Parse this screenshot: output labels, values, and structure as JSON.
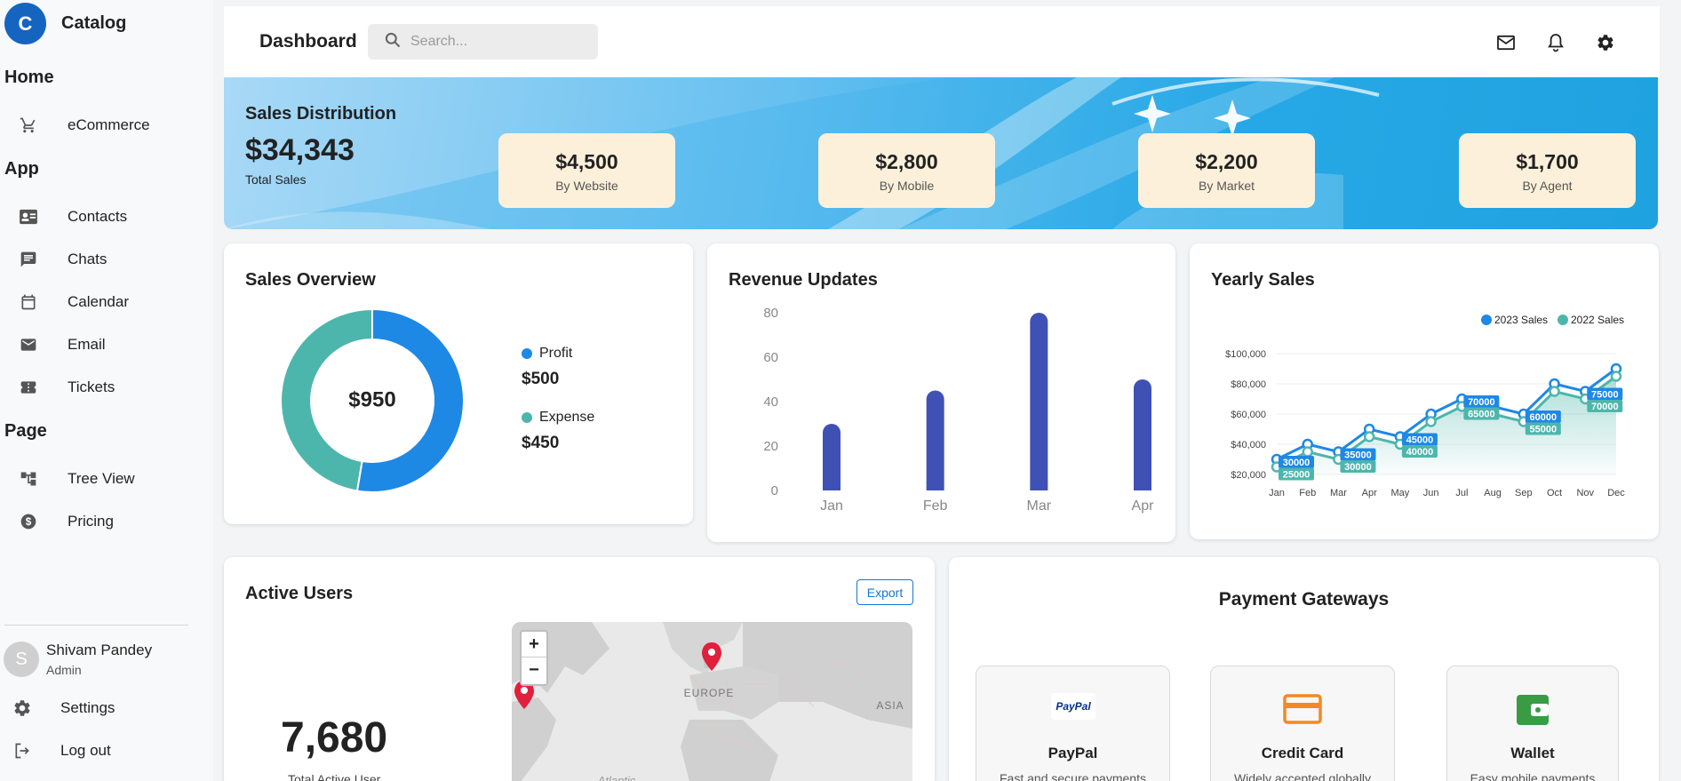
{
  "brand": {
    "logo_letter": "C",
    "name": "Catalog"
  },
  "sidebar": {
    "sections": [
      {
        "title": "Home",
        "items": [
          {
            "label": "eCommerce",
            "icon": "cart-icon"
          }
        ]
      },
      {
        "title": "App",
        "items": [
          {
            "label": "Contacts",
            "icon": "contact-card-icon"
          },
          {
            "label": "Chats",
            "icon": "chat-icon"
          },
          {
            "label": "Calendar",
            "icon": "calendar-icon"
          },
          {
            "label": "Email",
            "icon": "mail-icon"
          },
          {
            "label": "Tickets",
            "icon": "ticket-icon"
          }
        ]
      },
      {
        "title": "Page",
        "items": [
          {
            "label": "Tree View",
            "icon": "tree-icon"
          },
          {
            "label": "Pricing",
            "icon": "dollar-icon"
          }
        ]
      }
    ],
    "user": {
      "initial": "S",
      "name": "Shivam Pandey",
      "role": "Admin"
    },
    "settings_label": "Settings",
    "logout_label": "Log out"
  },
  "header": {
    "title": "Dashboard",
    "search_placeholder": "Search..."
  },
  "banner": {
    "title": "Sales Distribution",
    "total": "$34,343",
    "total_label": "Total Sales",
    "cards": [
      {
        "value": "$4,500",
        "label": "By Website"
      },
      {
        "value": "$2,800",
        "label": "By Mobile"
      },
      {
        "value": "$2,200",
        "label": "By Market"
      },
      {
        "value": "$1,700",
        "label": "By Agent"
      }
    ]
  },
  "colors": {
    "primary": "#1e88e5",
    "teal": "#4db6ac",
    "bar": "#3f51b5",
    "accent": "#1976d2"
  },
  "sales_overview": {
    "title": "Sales Overview",
    "center_value": "$950",
    "legend": [
      {
        "name": "Profit",
        "value": "$500"
      },
      {
        "name": "Expense",
        "value": "$450"
      }
    ]
  },
  "revenue": {
    "title": "Revenue Updates"
  },
  "yearly": {
    "title": "Yearly Sales"
  },
  "chart_data": [
    {
      "type": "pie",
      "title": "Sales Overview",
      "categories": [
        "Profit",
        "Expense"
      ],
      "values": [
        500,
        450
      ]
    },
    {
      "type": "bar",
      "title": "Revenue Updates",
      "categories": [
        "Jan",
        "Feb",
        "Mar",
        "Apr"
      ],
      "values": [
        30,
        45,
        80,
        50
      ],
      "yticks": [
        "0",
        "20",
        "40",
        "60",
        "80"
      ],
      "ylim": [
        0,
        80
      ]
    },
    {
      "type": "area",
      "title": "Yearly Sales",
      "categories": [
        "Jan",
        "Feb",
        "Mar",
        "Apr",
        "May",
        "Jun",
        "Jul",
        "Aug",
        "Sep",
        "Oct",
        "Nov",
        "Dec"
      ],
      "series": [
        {
          "name": "2023 Sales",
          "values": [
            30000,
            40000,
            35000,
            50000,
            45000,
            60000,
            70000,
            65000,
            60000,
            80000,
            75000,
            90000
          ]
        },
        {
          "name": "2022 Sales",
          "values": [
            25000,
            35000,
            30000,
            45000,
            40000,
            55000,
            65000,
            60000,
            55000,
            75000,
            70000,
            85000
          ]
        }
      ],
      "point_labels": [
        {
          "series": 0,
          "index": 0,
          "text": "30000"
        },
        {
          "series": 1,
          "index": 0,
          "text": "25000"
        },
        {
          "series": 0,
          "index": 2,
          "text": "35000"
        },
        {
          "series": 1,
          "index": 2,
          "text": "30000"
        },
        {
          "series": 0,
          "index": 4,
          "text": "45000"
        },
        {
          "series": 1,
          "index": 4,
          "text": "40000"
        },
        {
          "series": 0,
          "index": 6,
          "text": "70000"
        },
        {
          "series": 1,
          "index": 6,
          "text": "65000"
        },
        {
          "series": 0,
          "index": 8,
          "text": "60000"
        },
        {
          "series": 1,
          "index": 8,
          "text": "55000"
        },
        {
          "series": 0,
          "index": 10,
          "text": "75000"
        },
        {
          "series": 1,
          "index": 10,
          "text": "70000"
        }
      ],
      "yticks": [
        "$20,000",
        "$40,000",
        "$60,000",
        "$80,000",
        "$100,000"
      ],
      "ylim": [
        20000,
        100000
      ],
      "legend": "top-right"
    }
  ],
  "active_users": {
    "title": "Active Users",
    "export_label": "Export",
    "value": "7,680",
    "label": "Total Active User",
    "map": {
      "zoom_in": "+",
      "zoom_out": "−",
      "labels": [
        "EUROPE",
        "ASIA",
        "Atlantic"
      ]
    }
  },
  "payment": {
    "title": "Payment Gateways",
    "items": [
      {
        "name": "PayPal",
        "desc": "Fast and secure payments",
        "icon": "paypal-icon",
        "logo_text": "PayPal"
      },
      {
        "name": "Credit Card",
        "desc": "Widely accepted globally",
        "icon": "credit-card-icon"
      },
      {
        "name": "Wallet",
        "desc": "Easy mobile payments",
        "icon": "wallet-icon"
      }
    ]
  }
}
